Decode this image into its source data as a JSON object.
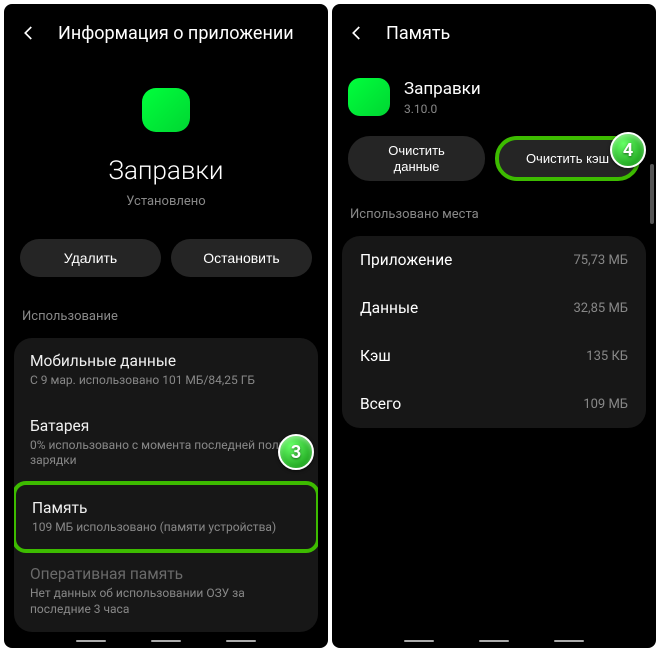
{
  "left": {
    "headerTitle": "Информация о приложении",
    "appName": "Заправки",
    "appStatus": "Установлено",
    "btnUninstall": "Удалить",
    "btnStop": "Остановить",
    "sectionUsage": "Использование",
    "items": [
      {
        "title": "Мобильные данные",
        "sub": "С 9 мар. использовано 101 МБ/84,25 ГБ"
      },
      {
        "title": "Батарея",
        "sub": "0% использовано с момента последней полной зарядки"
      },
      {
        "title": "Память",
        "sub": "109 МБ использовано (памяти устройства)"
      },
      {
        "title": "Оперативная память",
        "sub": "Нет данных об использовании ОЗУ за последние 3 часа"
      }
    ]
  },
  "right": {
    "headerTitle": "Память",
    "appName": "Заправки",
    "appVersion": "3.10.0",
    "btnClearData1": "Очистить",
    "btnClearData2": "данные",
    "btnClearCache": "Очистить кэш",
    "sectionUsed": "Использовано места",
    "rows": [
      {
        "label": "Приложение",
        "val": "75,73 МБ"
      },
      {
        "label": "Данные",
        "val": "32,85 МБ"
      },
      {
        "label": "Кэш",
        "val": "135 КБ"
      },
      {
        "label": "Всего",
        "val": "109 МБ"
      }
    ]
  },
  "steps": {
    "s3": "3",
    "s4": "4"
  }
}
